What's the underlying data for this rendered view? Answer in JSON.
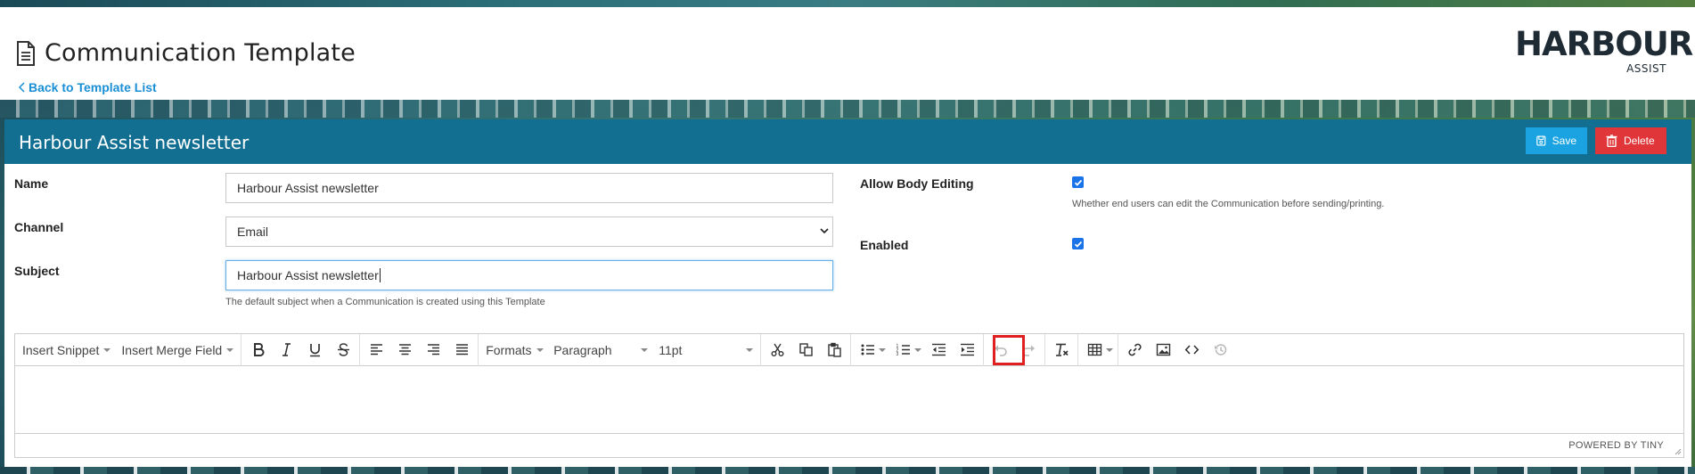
{
  "header": {
    "page_title": "Communication Template",
    "back_link": "Back to Template List",
    "logo_text": "HARBOUR",
    "logo_sub": "ASSIST"
  },
  "card": {
    "title": "Harbour Assist newsletter",
    "save_label": "Save",
    "delete_label": "Delete"
  },
  "form": {
    "name_label": "Name",
    "name_value": "Harbour Assist newsletter",
    "channel_label": "Channel",
    "channel_value": "Email",
    "subject_label": "Subject",
    "subject_value": "Harbour Assist newsletter",
    "subject_help": "The default subject when a Communication is created using this Template",
    "allow_body_label": "Allow Body Editing",
    "allow_body_checked": true,
    "allow_body_help": "Whether end users can edit the Communication before sending/printing.",
    "enabled_label": "Enabled",
    "enabled_checked": true
  },
  "editor": {
    "insert_snippet": "Insert Snippet",
    "insert_merge_field": "Insert Merge Field",
    "formats": "Formats",
    "paragraph": "Paragraph",
    "font_size": "11pt",
    "powered_by": "POWERED BY TINY",
    "highlighted_button": "source-code"
  },
  "colors": {
    "header_bar": "#126f91",
    "save": "#1aa3e0",
    "delete": "#e0363a",
    "link": "#1a8fd6",
    "highlight_box": "#e02020"
  }
}
